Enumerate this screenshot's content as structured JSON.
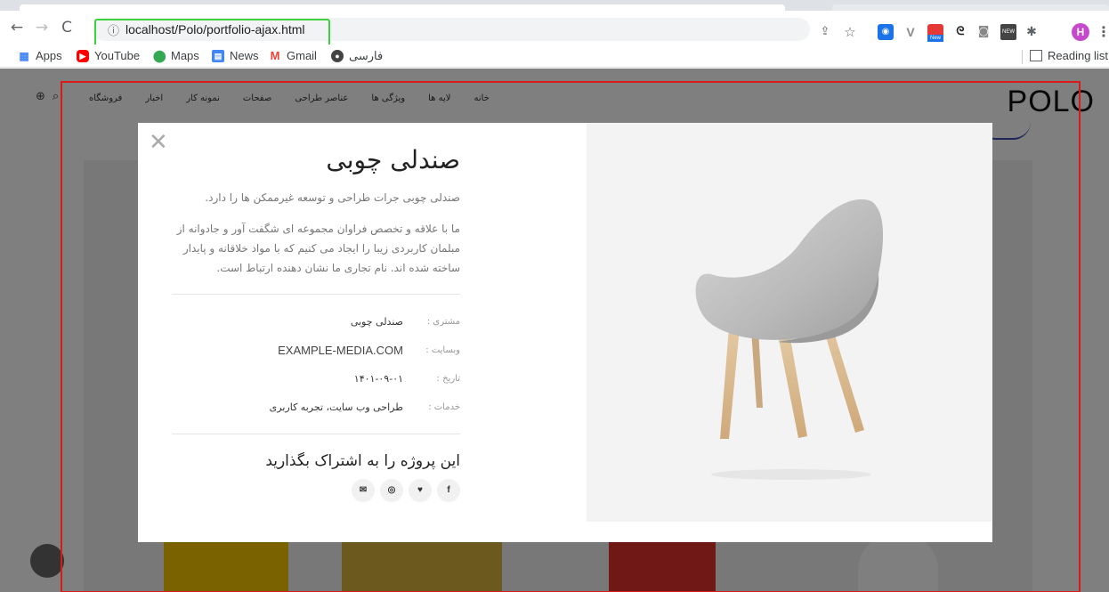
{
  "browser": {
    "url": "localhost/Polo/portfolio-ajax.html",
    "avatar_letter": "H",
    "bookmarks": [
      {
        "label": "Apps",
        "icon": "apps-grid-icon"
      },
      {
        "label": "YouTube",
        "icon": "youtube-icon"
      },
      {
        "label": "Maps",
        "icon": "maps-pin-icon"
      },
      {
        "label": "News",
        "icon": "news-icon"
      },
      {
        "label": "Gmail",
        "icon": "gmail-icon"
      },
      {
        "label": "فارسی",
        "icon": "globe-icon"
      }
    ],
    "reading_list": "Reading list",
    "extension_new_label": "New"
  },
  "site": {
    "logo": "POLO",
    "menu": [
      "خانه",
      "لایه ها",
      "ویژگی ها",
      "عناصر طراحی",
      "صفحات",
      "نمونه کار",
      "اخبار",
      "فروشگاه"
    ],
    "tools": [
      "search-icon",
      "globe-icon"
    ]
  },
  "modal": {
    "title": "صندلی چوبی",
    "subtitle": "صندلی چوبی جرات طراحی و توسعه غیرممکن ها را دارد.",
    "description": "ما با علاقه و تخصص فراوان مجموعه ای شگفت آور و جادوانه از مبلمان کاربردی زیبا را ایجاد می کنیم که با مواد خلاقانه و پایدار ساخته شده اند. نام تجاری ما نشان دهنده ارتباط است.",
    "info": [
      {
        "label": "مشتری :",
        "value": "صندلی چوبی"
      },
      {
        "label": "وبسایت :",
        "value": "EXAMPLE-MEDIA.COM"
      },
      {
        "label": "تاریخ :",
        "value": "۱۴۰۱-۰۹-۰۱"
      },
      {
        "label": "خدمات :",
        "value": "طراحی وب سایت، تجربه کاربری"
      }
    ],
    "share_title": "این پروژه را به اشتراک بگذارید",
    "socials": [
      {
        "name": "facebook-icon",
        "glyph": "f"
      },
      {
        "name": "twitter-icon",
        "glyph": "♥"
      },
      {
        "name": "instagram-icon",
        "glyph": "◎"
      },
      {
        "name": "email-icon",
        "glyph": "✉"
      }
    ]
  },
  "colors": {
    "overlay": "#00000080",
    "highlight_frame": "#d71a1a",
    "url_highlight": "#3ed13e"
  }
}
